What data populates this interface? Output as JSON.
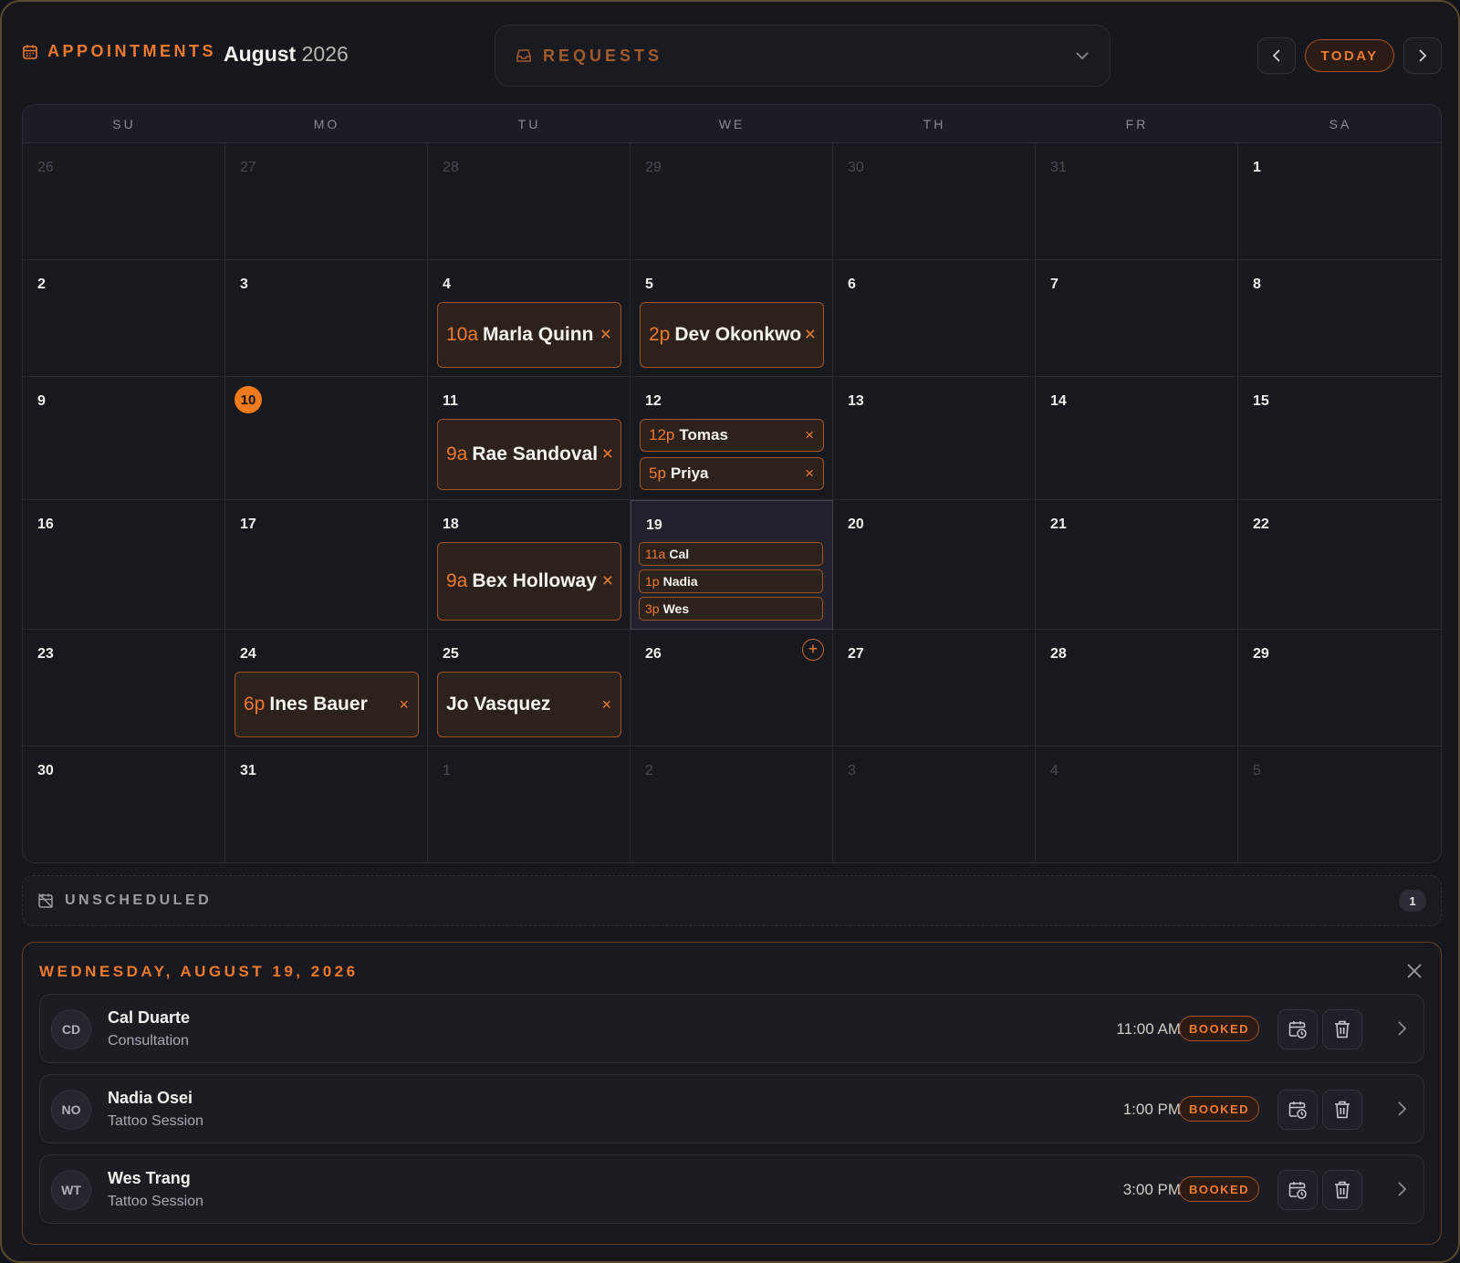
{
  "header": {
    "label": "APPOINTMENTS",
    "month": "August",
    "year": "2026",
    "requests_label": "REQUESTS",
    "today_label": "TODAY"
  },
  "calendar": {
    "weekdays": [
      "SU",
      "MO",
      "TU",
      "WE",
      "TH",
      "FR",
      "SA"
    ],
    "today": "10",
    "weeks": [
      [
        "26",
        "27",
        "28",
        "29",
        "30",
        "31",
        "1"
      ],
      [
        "2",
        "3",
        "4",
        "5",
        "6",
        "7",
        "8"
      ],
      [
        "9",
        "10",
        "11",
        "12",
        "13",
        "14",
        "15"
      ],
      [
        "16",
        "17",
        "18",
        "19",
        "20",
        "21",
        "22"
      ],
      [
        "23",
        "24",
        "25",
        "26",
        "27",
        "28",
        "29"
      ],
      [
        "30",
        "31",
        "1",
        "2",
        "3",
        "4",
        "5"
      ]
    ],
    "events": {
      "marla": {
        "time": "10a",
        "name": "Marla Quinn"
      },
      "dev": {
        "time": "2p",
        "name": "Dev Okonkwo"
      },
      "rae": {
        "time": "9a",
        "name": "Rae Sandoval"
      },
      "tomas": {
        "time": "12p",
        "name": "Tomas"
      },
      "priya": {
        "time": "5p",
        "name": "Priya"
      },
      "bex": {
        "time": "9a",
        "name": "Bex Holloway"
      },
      "cal": {
        "time": "11a",
        "name": "Cal"
      },
      "nadia": {
        "time": "1p",
        "name": "Nadia"
      },
      "wes": {
        "time": "3p",
        "name": "Wes"
      },
      "ines": {
        "time": "6p",
        "name": "Ines Bauer"
      },
      "jo": {
        "time": "",
        "name": "Jo Vasquez"
      }
    },
    "close_glyph": "×",
    "add_glyph": "+"
  },
  "unscheduled": {
    "label": "UNSCHEDULED",
    "count": "1"
  },
  "detail": {
    "title": "WEDNESDAY, AUGUST 19, 2026",
    "appointments": [
      {
        "initials": "CD",
        "name": "Cal Duarte",
        "service": "Consultation",
        "time": "11:00 AM",
        "status": "BOOKED"
      },
      {
        "initials": "NO",
        "name": "Nadia Osei",
        "service": "Tattoo Session",
        "time": "1:00 PM",
        "status": "BOOKED"
      },
      {
        "initials": "WT",
        "name": "Wes Trang",
        "service": "Tattoo Session",
        "time": "3:00 PM",
        "status": "BOOKED"
      }
    ]
  },
  "colors": {
    "accent": "#f07a2e",
    "background": "#17171e"
  }
}
